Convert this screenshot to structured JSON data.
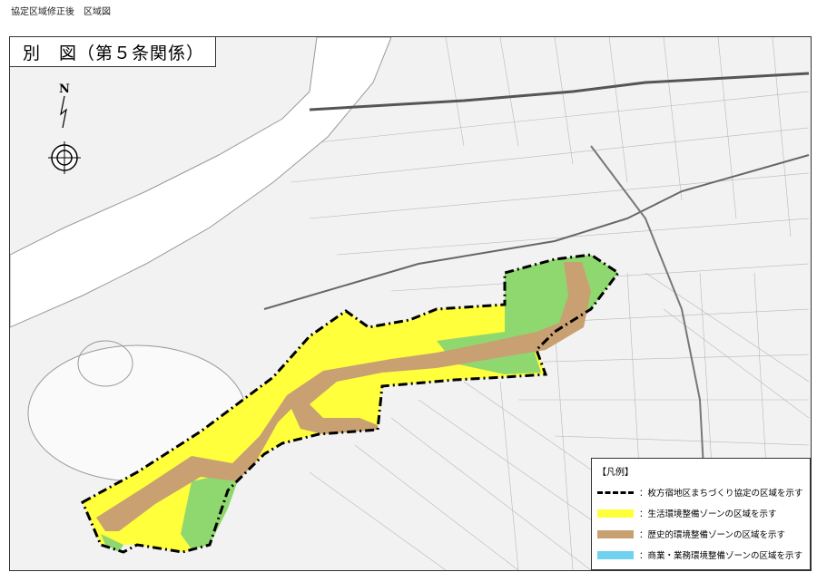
{
  "header": {
    "caption": "協定区域修正後　区域図"
  },
  "title": {
    "text": "別　図（第５条関係）"
  },
  "compass": {
    "label": "N"
  },
  "legend": {
    "title": "【凡例】",
    "items": [
      {
        "kind": "line",
        "color": "#000000",
        "label": "：枚方宿地区まちづくり協定の区域を示す"
      },
      {
        "kind": "fill",
        "color": "#ffff3c",
        "label": "：生活環境整備ゾーンの区域を示す"
      },
      {
        "kind": "fill",
        "color": "#c9a071",
        "label": "：歴史的環境整備ゾーンの区域を示す"
      },
      {
        "kind": "fill",
        "color": "#6fd3f0",
        "label": "：商業・業務環境整備ゾーンの区域を示す"
      }
    ]
  },
  "colors": {
    "living_zone": "#ffff3c",
    "historic_zone": "#c9a071",
    "green_zone": "#8fd870",
    "river": "#ffffff",
    "boundary": "#000000"
  }
}
